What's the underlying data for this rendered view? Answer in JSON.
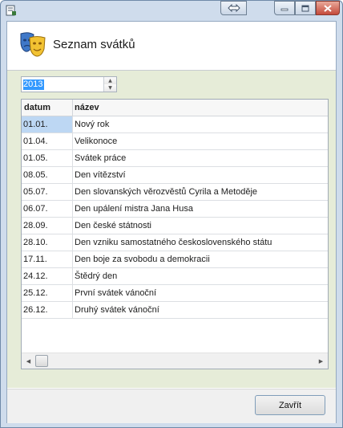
{
  "window": {
    "title": "",
    "controls": [
      "restore-icon",
      "minimize-icon",
      "maximize-icon",
      "close-icon"
    ]
  },
  "header": {
    "title": "Seznam svátků",
    "icon": "theater-masks-icon"
  },
  "year_picker": {
    "value": "2013"
  },
  "table": {
    "columns": [
      "datum",
      "název"
    ],
    "rows": [
      {
        "date": "01.01.",
        "name": "Nový rok"
      },
      {
        "date": "01.04.",
        "name": "Velikonoce"
      },
      {
        "date": "01.05.",
        "name": "Svátek práce"
      },
      {
        "date": "08.05.",
        "name": "Den vítězství"
      },
      {
        "date": "05.07.",
        "name": "Den slovanských věrozvěstů Cyrila a Metoděje"
      },
      {
        "date": "06.07.",
        "name": "Den upálení mistra Jana Husa"
      },
      {
        "date": "28.09.",
        "name": "Den české státnosti"
      },
      {
        "date": "28.10.",
        "name": "Den vzniku samostatného československého státu"
      },
      {
        "date": "17.11.",
        "name": "Den boje za svobodu a demokracii"
      },
      {
        "date": "24.12.",
        "name": "Štědrý den"
      },
      {
        "date": "25.12.",
        "name": "První svátek vánoční"
      },
      {
        "date": "26.12.",
        "name": "Druhý svátek vánoční"
      }
    ],
    "selected_row": 0
  },
  "footer": {
    "close_label": "Zavřít"
  },
  "colors": {
    "window_frame": "#cfdcec",
    "content_bg": "#e6ecd8",
    "selection": "#bdd7f3",
    "input_highlight": "#3399ff"
  }
}
